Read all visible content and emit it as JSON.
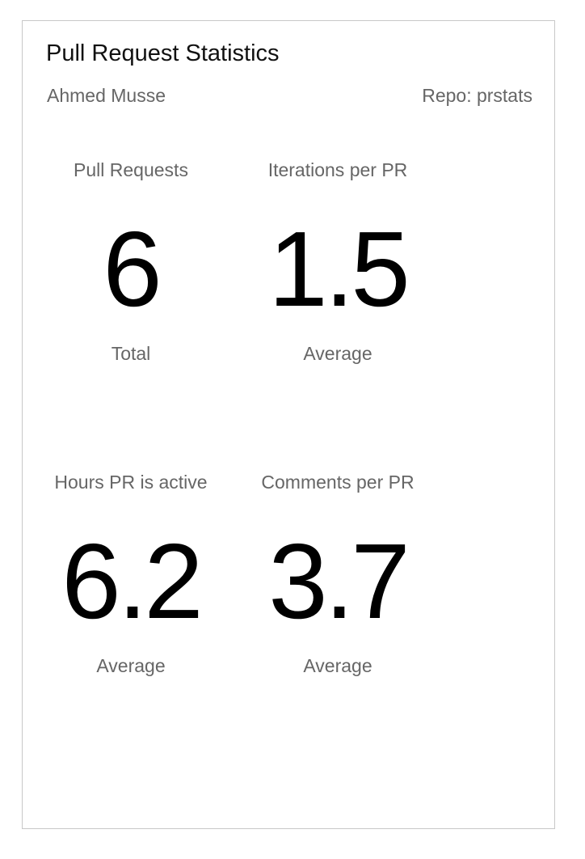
{
  "header": {
    "title": "Pull Request Statistics",
    "author": "Ahmed Musse",
    "repo": "Repo: prstats"
  },
  "metrics": [
    {
      "label": "Pull Requests",
      "value": "6",
      "sub": "Total"
    },
    {
      "label": "Iterations per PR",
      "value": "1.5",
      "sub": "Average"
    },
    {
      "label": "Hours PR is active",
      "value": "6.2",
      "sub": "Average"
    },
    {
      "label": "Comments per PR",
      "value": "3.7",
      "sub": "Average"
    }
  ]
}
